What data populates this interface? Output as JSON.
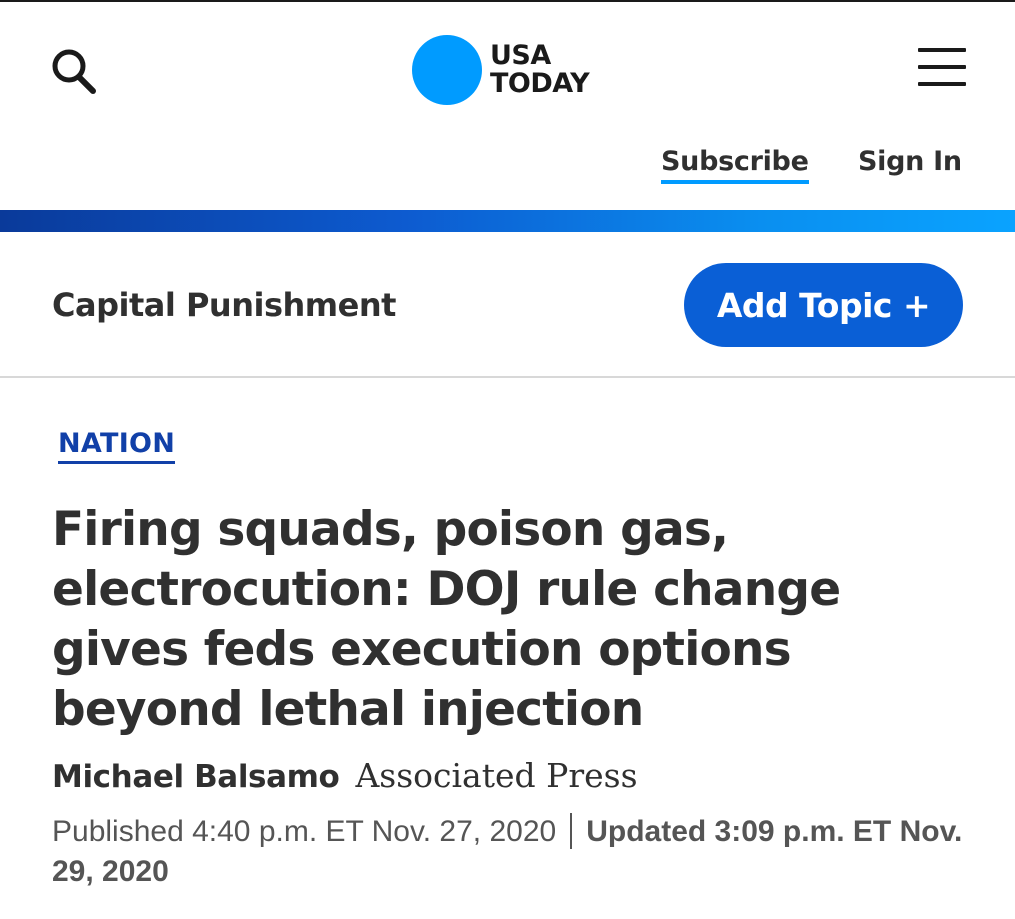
{
  "header": {
    "logo": {
      "line1": "USA",
      "line2": "TODAY",
      "dot_color": "#009bff"
    },
    "search_icon": "search-icon",
    "menu_icon": "hamburger-menu-icon",
    "subscribe_label": "Subscribe",
    "sign_in_label": "Sign In"
  },
  "topic": {
    "title": "Capital Punishment",
    "add_topic_label": "Add Topic +"
  },
  "article": {
    "section": "NATION",
    "headline": "Firing squads, poison gas, electrocution: DOJ rule change gives feds execution options beyond lethal injection",
    "author": "Michael Balsamo",
    "outlet": "Associated Press",
    "published": "Published 4:40 p.m. ET Nov. 27, 2020",
    "updated": "Updated 3:09 p.m. ET Nov. 29, 2020"
  },
  "colors": {
    "accent_blue": "#009bff",
    "button_blue": "#0a5fd6",
    "section_link": "#1140a8",
    "text": "#303030"
  }
}
